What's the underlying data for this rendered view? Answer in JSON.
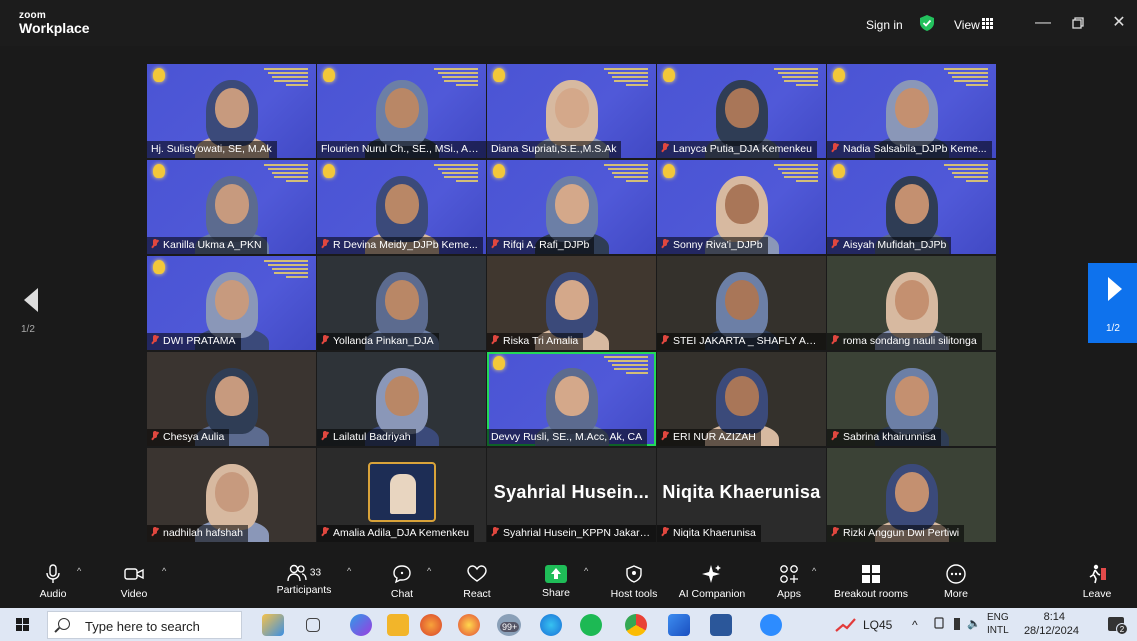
{
  "app": {
    "logo_line1": "zoom",
    "logo_line2": "Workplace"
  },
  "titlebar": {
    "sign_in": "Sign in",
    "view": "View"
  },
  "nav": {
    "left_page": "1/2",
    "right_page": "1/2"
  },
  "participants": [
    {
      "name": "Hj. Sulistyowati, SE, M.Ak",
      "muted": false,
      "bg": "blue"
    },
    {
      "name": "Flourien Nurul Ch., SE., MSi., Ak...",
      "muted": false,
      "bg": "blue"
    },
    {
      "name": "Diana Supriati,S.E.,M.S.Ak",
      "muted": false,
      "bg": "blue"
    },
    {
      "name": "Lanyca Putia_DJA Kemenkeu",
      "muted": true,
      "bg": "blue"
    },
    {
      "name": "Nadia Salsabila_DJPb Keme...",
      "muted": true,
      "bg": "blue"
    },
    {
      "name": "Kanilla Ukma A_PKN",
      "muted": true,
      "bg": "blue"
    },
    {
      "name": "R Devina Meidy_DJPb Keme...",
      "muted": true,
      "bg": "blue"
    },
    {
      "name": "Rifqi A. Rafi_DJPb",
      "muted": true,
      "bg": "blue"
    },
    {
      "name": "Sonny Riva'i_DJPb",
      "muted": true,
      "bg": "blue"
    },
    {
      "name": "Aisyah Mufidah_DJPb",
      "muted": true,
      "bg": "blue"
    },
    {
      "name": "DWI PRATAMA",
      "muted": true,
      "bg": "blue"
    },
    {
      "name": "Yollanda Pinkan_DJA",
      "muted": true,
      "bg": "photo"
    },
    {
      "name": "Riska Tri Amalia",
      "muted": true,
      "bg": "photo"
    },
    {
      "name": "STEI JAKARTA _ SHAFLY AL N...",
      "muted": true,
      "bg": "photo"
    },
    {
      "name": "roma sondang nauli silitonga",
      "muted": true,
      "bg": "photo"
    },
    {
      "name": "Chesya Aulia",
      "muted": true,
      "bg": "photo"
    },
    {
      "name": "Lailatul Badriyah",
      "muted": true,
      "bg": "photo"
    },
    {
      "name": "Devvy Rusli, SE., M.Acc, Ak, CA",
      "muted": false,
      "bg": "blue",
      "active": true
    },
    {
      "name": "ERI NUR AZIZAH",
      "muted": true,
      "bg": "photo"
    },
    {
      "name": "Sabrina khairunnisa",
      "muted": true,
      "bg": "photo"
    },
    {
      "name": "nadhilah hafshah",
      "muted": true,
      "bg": "photo"
    },
    {
      "name": "Amalia Adila_DJA Kemenkeu",
      "muted": true,
      "bg": "avatar"
    },
    {
      "name": "Syahrial Husein_KPPN Jakart...",
      "muted": true,
      "bg": "text",
      "display": "Syahrial  Husein..."
    },
    {
      "name": "Niqita Khaerunisa",
      "muted": true,
      "bg": "text",
      "display": "Niqita Khaerunisa"
    },
    {
      "name": "Rizki Anggun Dwi Pertiwi",
      "muted": true,
      "bg": "photo"
    }
  ],
  "toolbar": {
    "audio": "Audio",
    "video": "Video",
    "participants": "Participants",
    "participants_count": "33",
    "chat": "Chat",
    "react": "React",
    "share": "Share",
    "host_tools": "Host tools",
    "ai_companion": "AI Companion",
    "apps": "Apps",
    "breakout_rooms": "Breakout rooms",
    "more": "More",
    "leave": "Leave"
  },
  "taskbar": {
    "search_placeholder": "Type here to search",
    "badge": "99+",
    "weather": "LQ45",
    "lang1": "ENG",
    "lang2": "INTL",
    "time": "8:14",
    "date": "28/12/2024",
    "notifications": "2"
  },
  "colors": {
    "accent": "#0e72ed",
    "active_speaker": "#23d959",
    "share": "#1fbd58",
    "muted": "#e0473f",
    "tile_blue": "#4a54d4"
  }
}
